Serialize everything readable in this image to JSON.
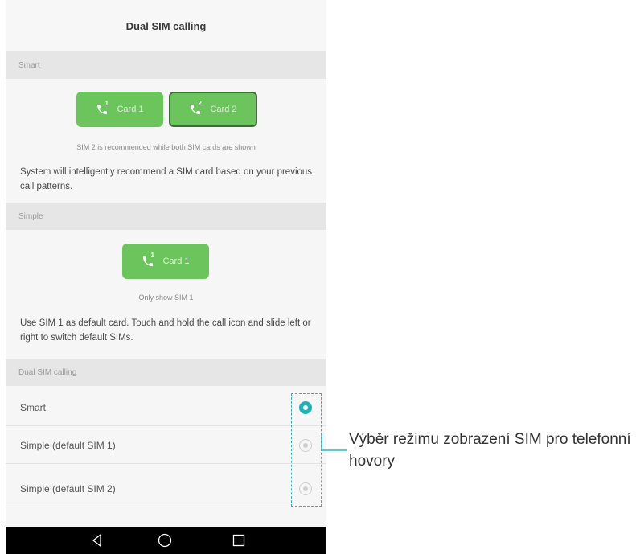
{
  "title": "Dual SIM calling",
  "smart_section": {
    "header": "Smart",
    "card1_label": "Card 1",
    "card1_num": "1",
    "card2_label": "Card 2",
    "card2_num": "2",
    "caption": "SIM 2 is recommended while both SIM cards are shown",
    "description": "System will intelligently recommend a SIM card based on your previous call patterns."
  },
  "simple_section": {
    "header": "Simple",
    "card1_label": "Card 1",
    "card1_num": "1",
    "caption": "Only show SIM 1",
    "description": "Use SIM 1 as default card. Touch and hold the call icon and slide left or right to switch default SIMs."
  },
  "calling_section": {
    "header": "Dual SIM calling",
    "options": [
      {
        "label": "Smart",
        "selected": true
      },
      {
        "label": "Simple (default SIM 1)",
        "selected": false
      },
      {
        "label": "Simple (default SIM 2)",
        "selected": false
      }
    ]
  },
  "navbar": {
    "icons": [
      "back-icon",
      "home-icon",
      "recents-icon"
    ]
  },
  "annotation": "Výběr režimu zobrazení SIM pro telefonní hovory",
  "colors": {
    "accent": "#1fb3b8",
    "card_green": "#6cc55c",
    "callout": "#2fb5c0"
  }
}
